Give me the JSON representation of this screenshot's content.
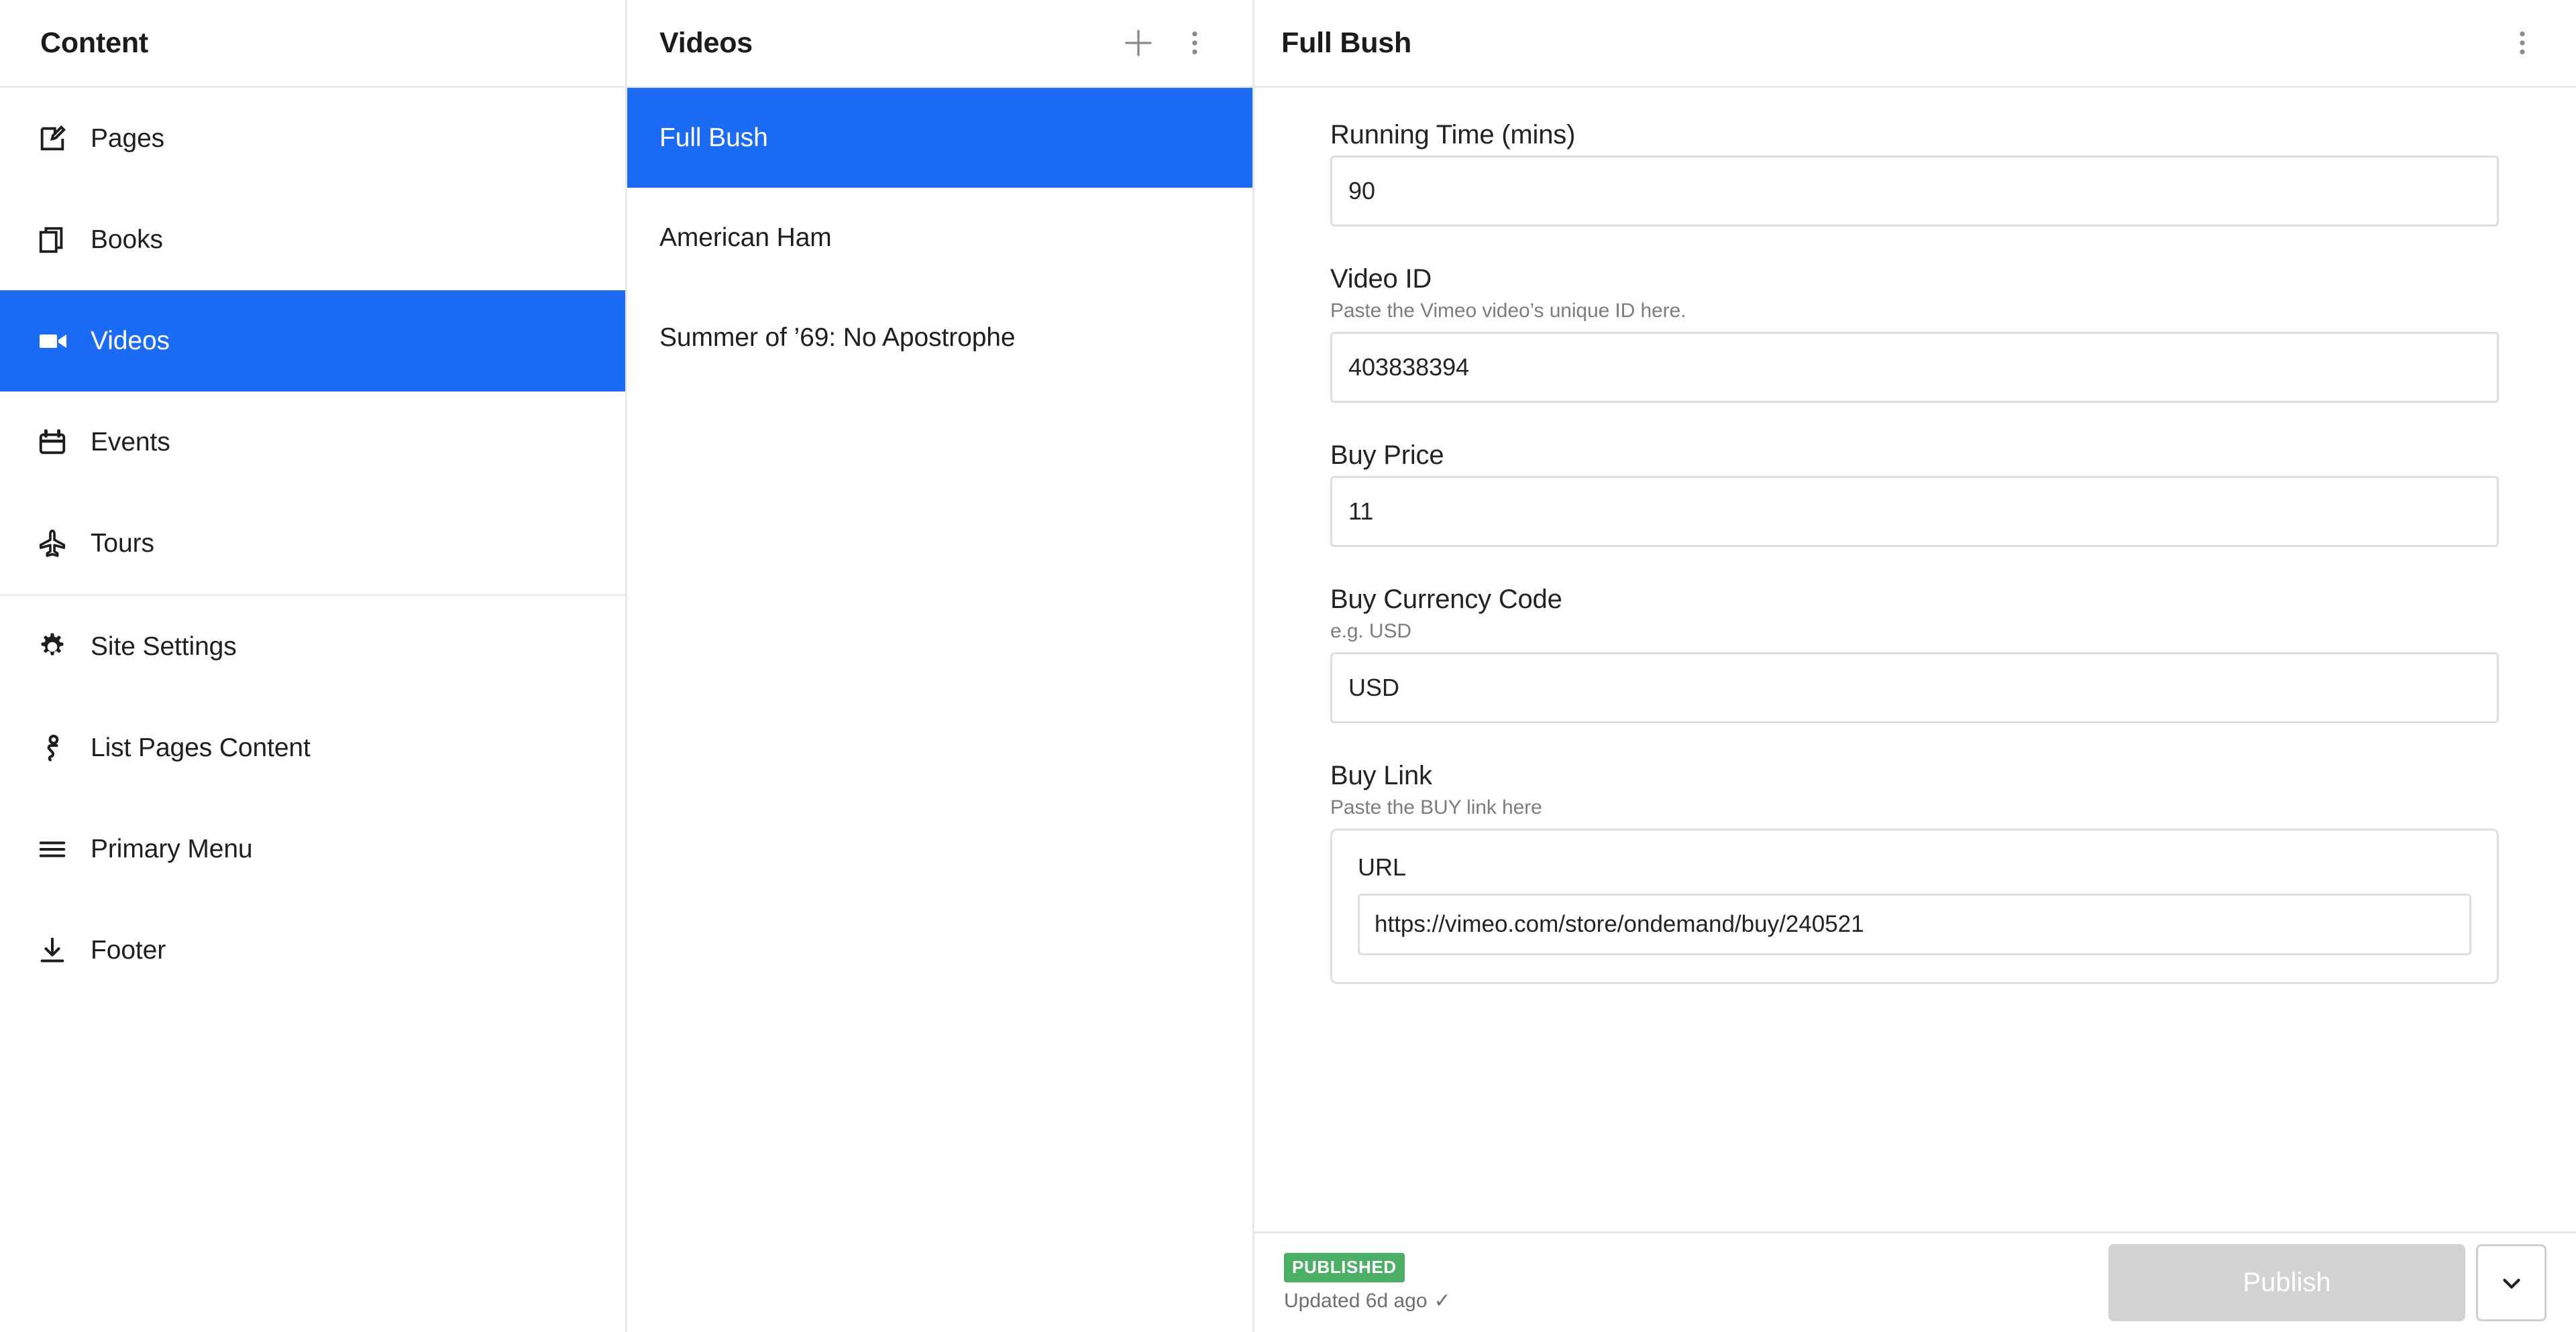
{
  "sidebar": {
    "header_title": "Content",
    "groups": [
      {
        "divided": true,
        "items": [
          {
            "label": "Pages",
            "icon": "edit-square-icon",
            "active": false
          },
          {
            "label": "Books",
            "icon": "books-stack-icon",
            "active": false
          },
          {
            "label": "Videos",
            "icon": "video-camera-icon",
            "active": true
          },
          {
            "label": "Events",
            "icon": "calendar-icon",
            "active": false
          },
          {
            "label": "Tours",
            "icon": "airplane-icon",
            "active": false
          }
        ]
      },
      {
        "divided": false,
        "items": [
          {
            "label": "Site Settings",
            "icon": "gear-icon",
            "active": false
          },
          {
            "label": "List Pages Content",
            "icon": "info-person-icon",
            "active": false
          },
          {
            "label": "Primary Menu",
            "icon": "hamburger-menu-icon",
            "active": false
          },
          {
            "label": "Footer",
            "icon": "download-arrow-icon",
            "active": false
          }
        ]
      }
    ]
  },
  "list_column": {
    "header_title": "Videos",
    "add_icon": "plus-icon",
    "more_icon": "kebab-menu-icon",
    "items": [
      {
        "label": "Full Bush",
        "active": true
      },
      {
        "label": "American Ham",
        "active": false
      },
      {
        "label": "Summer of ’69: No Apostrophe",
        "active": false
      }
    ]
  },
  "detail": {
    "title": "Full Bush",
    "more_icon": "kebab-menu-icon",
    "fields": [
      {
        "label": "Running Time (mins)",
        "help": "",
        "value": "90",
        "name": "running-time"
      },
      {
        "label": "Video ID",
        "help": "Paste the Vimeo video’s unique ID here.",
        "value": "403838394",
        "name": "video-id"
      },
      {
        "label": "Buy Price",
        "help": "",
        "value": "11",
        "name": "buy-price"
      },
      {
        "label": "Buy Currency Code",
        "help": "e.g. USD",
        "value": "USD",
        "name": "buy-currency-code"
      }
    ],
    "buy_link": {
      "label": "Buy Link",
      "help": "Paste the BUY link here",
      "url_label": "URL",
      "url_value": "https://vimeo.com/store/ondemand/buy/240521",
      "name": "buy-link"
    }
  },
  "footer": {
    "status_badge": "PUBLISHED",
    "updated_text": "Updated 6d ago",
    "check_glyph": "✓",
    "publish_label": "Publish",
    "caret_icon": "chevron-down-icon"
  },
  "colors": {
    "accent_blue": "#1b6bf5",
    "published_green": "#4caf66",
    "disabled_grey": "#d2d2d2",
    "border_grey": "#dedede"
  }
}
